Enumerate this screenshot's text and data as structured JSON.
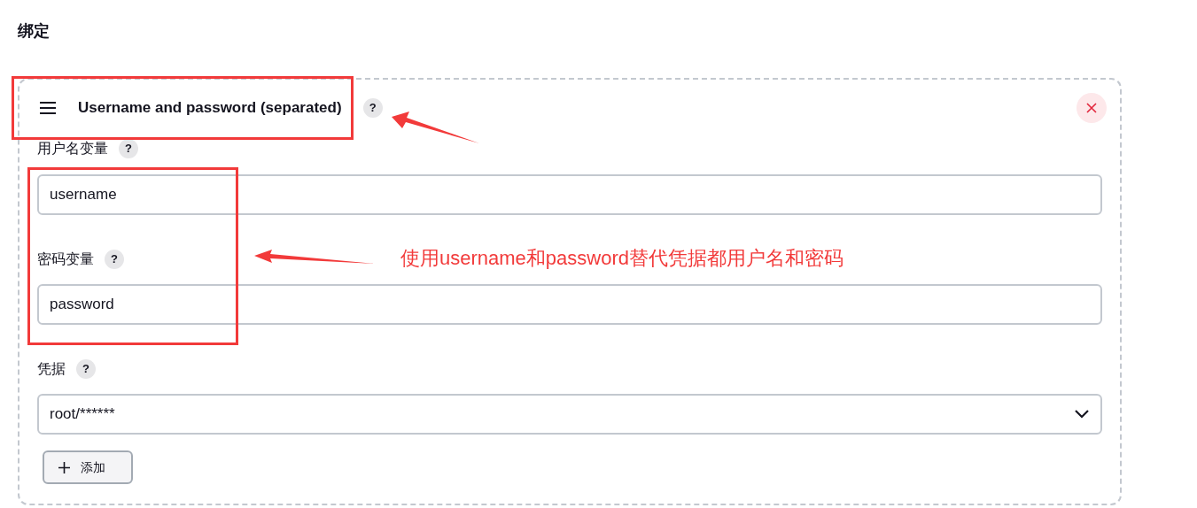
{
  "section_title": "绑定",
  "binding": {
    "title": "Username and password (separated)",
    "help": "?",
    "fields": [
      {
        "kind": "text",
        "label": "用户名变量",
        "help": "?",
        "value": "username"
      },
      {
        "kind": "text",
        "label": "密码变量",
        "help": "?",
        "value": "password"
      },
      {
        "kind": "select",
        "label": "凭据",
        "help": "?",
        "value": "root/******"
      }
    ],
    "add_button": "添加"
  },
  "annotation": "使用username和password替代凭据都用户名和密码"
}
